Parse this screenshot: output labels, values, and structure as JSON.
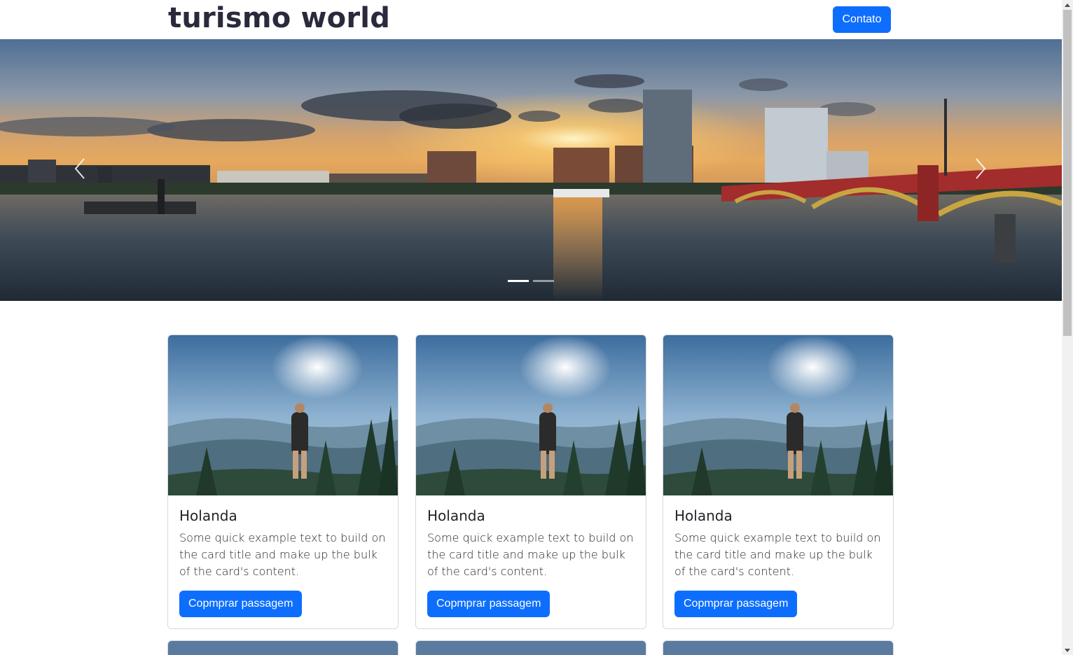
{
  "header": {
    "brand": "turismo world",
    "contact_label": "Contato"
  },
  "carousel": {
    "prev_icon": "chevron-left-icon",
    "next_icon": "chevron-right-icon",
    "slide_count": 2,
    "active_slide": 1
  },
  "cards": [
    {
      "title": "Holanda",
      "text": "Some quick example text to build on the card title and make up the bulk of the card's content.",
      "button": "Copmprar passagem"
    },
    {
      "title": "Holanda",
      "text": "Some quick example text to build on the card title and make up the bulk of the card's content.",
      "button": "Copmprar passagem"
    },
    {
      "title": "Holanda",
      "text": "Some quick example text to build on the card title and make up the bulk of the card's content.",
      "button": "Copmprar passagem"
    }
  ],
  "colors": {
    "primary": "#0d6efd",
    "brand_text": "#2a2a3d",
    "card_border": "#d7d9dc"
  }
}
